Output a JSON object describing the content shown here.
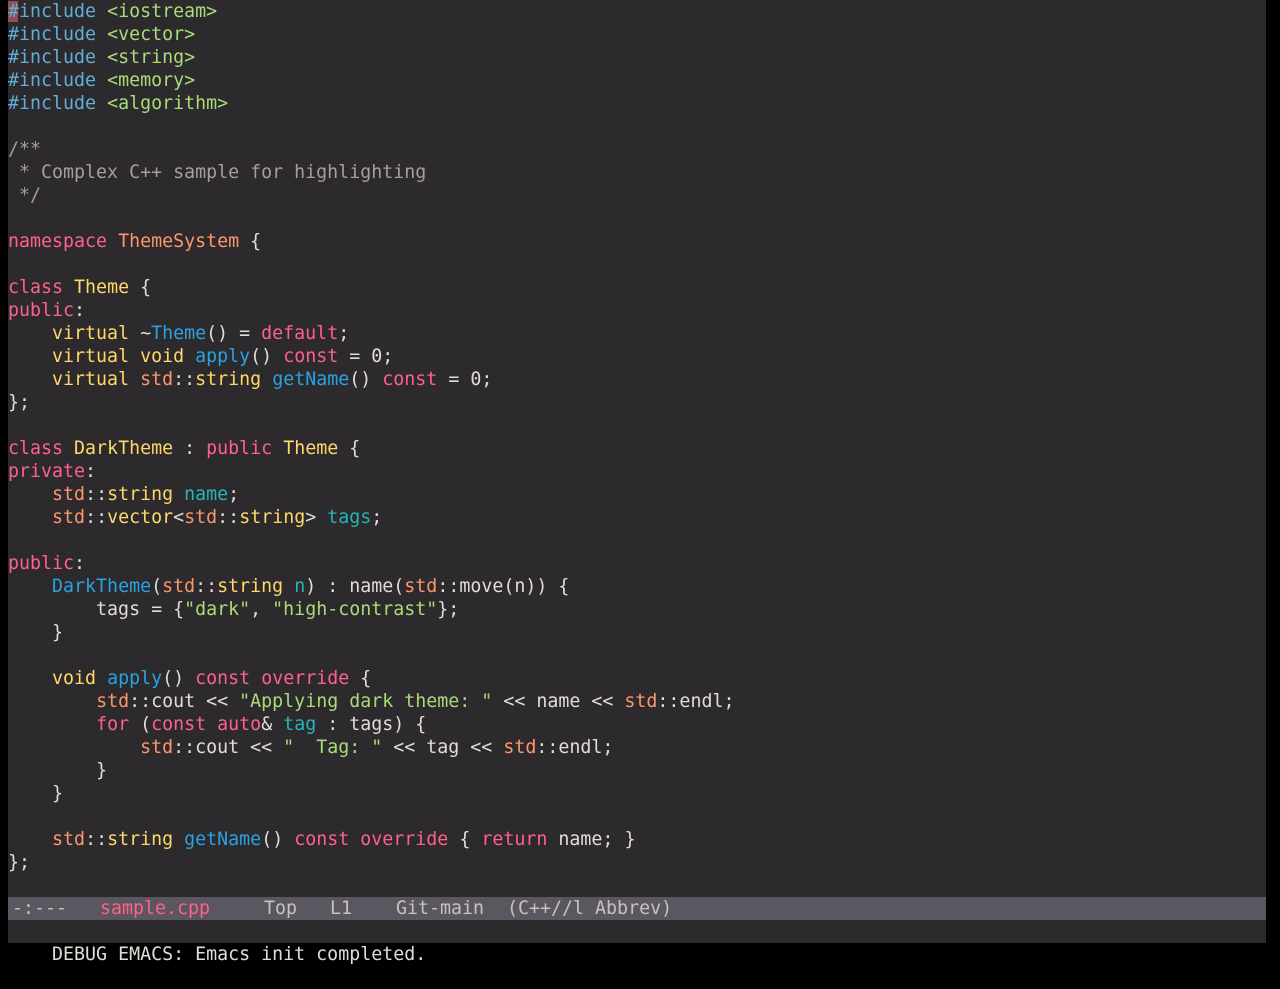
{
  "editor": {
    "lines": [
      [
        {
          "t": "#include",
          "c": "pre"
        },
        {
          "t": " ",
          "c": "plain"
        },
        {
          "t": "<iostream>",
          "c": "inc"
        }
      ],
      [
        {
          "t": "#include",
          "c": "pre"
        },
        {
          "t": " ",
          "c": "plain"
        },
        {
          "t": "<vector>",
          "c": "inc"
        }
      ],
      [
        {
          "t": "#include",
          "c": "pre"
        },
        {
          "t": " ",
          "c": "plain"
        },
        {
          "t": "<string>",
          "c": "inc"
        }
      ],
      [
        {
          "t": "#include",
          "c": "pre"
        },
        {
          "t": " ",
          "c": "plain"
        },
        {
          "t": "<memory>",
          "c": "inc"
        }
      ],
      [
        {
          "t": "#include",
          "c": "pre"
        },
        {
          "t": " ",
          "c": "plain"
        },
        {
          "t": "<algorithm>",
          "c": "inc"
        }
      ],
      [],
      [
        {
          "t": "/**",
          "c": "cmt"
        }
      ],
      [
        {
          "t": " * Complex C++ sample for highlighting",
          "c": "cmt"
        }
      ],
      [
        {
          "t": " */",
          "c": "cmt"
        }
      ],
      [],
      [
        {
          "t": "namespace",
          "c": "kw"
        },
        {
          "t": " ",
          "c": "plain"
        },
        {
          "t": "ThemeSystem",
          "c": "ns"
        },
        {
          "t": " {",
          "c": "plain"
        }
      ],
      [],
      [
        {
          "t": "class",
          "c": "kw"
        },
        {
          "t": " ",
          "c": "plain"
        },
        {
          "t": "Theme",
          "c": "type"
        },
        {
          "t": " {",
          "c": "plain"
        }
      ],
      [
        {
          "t": "public",
          "c": "kw"
        },
        {
          "t": ":",
          "c": "plain"
        }
      ],
      [
        {
          "t": "    ",
          "c": "plain"
        },
        {
          "t": "virtual",
          "c": "type"
        },
        {
          "t": " ~",
          "c": "plain"
        },
        {
          "t": "Theme",
          "c": "fn"
        },
        {
          "t": "() = ",
          "c": "plain"
        },
        {
          "t": "default",
          "c": "kw"
        },
        {
          "t": ";",
          "c": "plain"
        }
      ],
      [
        {
          "t": "    ",
          "c": "plain"
        },
        {
          "t": "virtual",
          "c": "type"
        },
        {
          "t": " ",
          "c": "plain"
        },
        {
          "t": "void",
          "c": "type"
        },
        {
          "t": " ",
          "c": "plain"
        },
        {
          "t": "apply",
          "c": "fn"
        },
        {
          "t": "() ",
          "c": "plain"
        },
        {
          "t": "const",
          "c": "kw"
        },
        {
          "t": " = 0;",
          "c": "plain"
        }
      ],
      [
        {
          "t": "    ",
          "c": "plain"
        },
        {
          "t": "virtual",
          "c": "type"
        },
        {
          "t": " ",
          "c": "plain"
        },
        {
          "t": "std",
          "c": "ns"
        },
        {
          "t": "::",
          "c": "plain"
        },
        {
          "t": "string",
          "c": "type"
        },
        {
          "t": " ",
          "c": "plain"
        },
        {
          "t": "getName",
          "c": "fn"
        },
        {
          "t": "() ",
          "c": "plain"
        },
        {
          "t": "const",
          "c": "kw"
        },
        {
          "t": " = 0;",
          "c": "plain"
        }
      ],
      [
        {
          "t": "};",
          "c": "plain"
        }
      ],
      [],
      [
        {
          "t": "class",
          "c": "kw"
        },
        {
          "t": " ",
          "c": "plain"
        },
        {
          "t": "DarkTheme",
          "c": "type"
        },
        {
          "t": " : ",
          "c": "plain"
        },
        {
          "t": "public",
          "c": "kw"
        },
        {
          "t": " ",
          "c": "plain"
        },
        {
          "t": "Theme",
          "c": "type"
        },
        {
          "t": " {",
          "c": "plain"
        }
      ],
      [
        {
          "t": "private",
          "c": "kw"
        },
        {
          "t": ":",
          "c": "plain"
        }
      ],
      [
        {
          "t": "    ",
          "c": "plain"
        },
        {
          "t": "std",
          "c": "ns"
        },
        {
          "t": "::",
          "c": "plain"
        },
        {
          "t": "string",
          "c": "type"
        },
        {
          "t": " ",
          "c": "plain"
        },
        {
          "t": "name",
          "c": "var"
        },
        {
          "t": ";",
          "c": "plain"
        }
      ],
      [
        {
          "t": "    ",
          "c": "plain"
        },
        {
          "t": "std",
          "c": "ns"
        },
        {
          "t": "::",
          "c": "plain"
        },
        {
          "t": "vector",
          "c": "type"
        },
        {
          "t": "<",
          "c": "plain"
        },
        {
          "t": "std",
          "c": "ns"
        },
        {
          "t": "::",
          "c": "plain"
        },
        {
          "t": "string",
          "c": "type"
        },
        {
          "t": "> ",
          "c": "plain"
        },
        {
          "t": "tags",
          "c": "var"
        },
        {
          "t": ";",
          "c": "plain"
        }
      ],
      [],
      [
        {
          "t": "public",
          "c": "kw"
        },
        {
          "t": ":",
          "c": "plain"
        }
      ],
      [
        {
          "t": "    ",
          "c": "plain"
        },
        {
          "t": "DarkTheme",
          "c": "fn"
        },
        {
          "t": "(",
          "c": "plain"
        },
        {
          "t": "std",
          "c": "ns"
        },
        {
          "t": "::",
          "c": "plain"
        },
        {
          "t": "string",
          "c": "type"
        },
        {
          "t": " ",
          "c": "plain"
        },
        {
          "t": "n",
          "c": "var"
        },
        {
          "t": ") : name(",
          "c": "plain"
        },
        {
          "t": "std",
          "c": "ns"
        },
        {
          "t": "::move(n)) {",
          "c": "plain"
        }
      ],
      [
        {
          "t": "        tags = {",
          "c": "plain"
        },
        {
          "t": "\"dark\"",
          "c": "str"
        },
        {
          "t": ", ",
          "c": "plain"
        },
        {
          "t": "\"high-contrast\"",
          "c": "str"
        },
        {
          "t": "};",
          "c": "plain"
        }
      ],
      [
        {
          "t": "    }",
          "c": "plain"
        }
      ],
      [],
      [
        {
          "t": "    ",
          "c": "plain"
        },
        {
          "t": "void",
          "c": "type"
        },
        {
          "t": " ",
          "c": "plain"
        },
        {
          "t": "apply",
          "c": "fn"
        },
        {
          "t": "() ",
          "c": "plain"
        },
        {
          "t": "const",
          "c": "kw"
        },
        {
          "t": " ",
          "c": "plain"
        },
        {
          "t": "override",
          "c": "kw"
        },
        {
          "t": " {",
          "c": "plain"
        }
      ],
      [
        {
          "t": "        ",
          "c": "plain"
        },
        {
          "t": "std",
          "c": "ns"
        },
        {
          "t": "::cout << ",
          "c": "plain"
        },
        {
          "t": "\"Applying dark theme: \"",
          "c": "str"
        },
        {
          "t": " << name << ",
          "c": "plain"
        },
        {
          "t": "std",
          "c": "ns"
        },
        {
          "t": "::endl;",
          "c": "plain"
        }
      ],
      [
        {
          "t": "        ",
          "c": "plain"
        },
        {
          "t": "for",
          "c": "kw"
        },
        {
          "t": " (",
          "c": "plain"
        },
        {
          "t": "const",
          "c": "kw"
        },
        {
          "t": " ",
          "c": "plain"
        },
        {
          "t": "auto",
          "c": "kw"
        },
        {
          "t": "& ",
          "c": "plain"
        },
        {
          "t": "tag",
          "c": "var"
        },
        {
          "t": " : tags) {",
          "c": "plain"
        }
      ],
      [
        {
          "t": "            ",
          "c": "plain"
        },
        {
          "t": "std",
          "c": "ns"
        },
        {
          "t": "::cout << ",
          "c": "plain"
        },
        {
          "t": "\"  Tag: \"",
          "c": "str"
        },
        {
          "t": " << tag << ",
          "c": "plain"
        },
        {
          "t": "std",
          "c": "ns"
        },
        {
          "t": "::endl;",
          "c": "plain"
        }
      ],
      [
        {
          "t": "        }",
          "c": "plain"
        }
      ],
      [
        {
          "t": "    }",
          "c": "plain"
        }
      ],
      [],
      [
        {
          "t": "    ",
          "c": "plain"
        },
        {
          "t": "std",
          "c": "ns"
        },
        {
          "t": "::",
          "c": "plain"
        },
        {
          "t": "string",
          "c": "type"
        },
        {
          "t": " ",
          "c": "plain"
        },
        {
          "t": "getName",
          "c": "fn"
        },
        {
          "t": "() ",
          "c": "plain"
        },
        {
          "t": "const",
          "c": "kw"
        },
        {
          "t": " ",
          "c": "plain"
        },
        {
          "t": "override",
          "c": "kw"
        },
        {
          "t": " { ",
          "c": "plain"
        },
        {
          "t": "return",
          "c": "kw"
        },
        {
          "t": " name; }",
          "c": "plain"
        }
      ],
      [
        {
          "t": "};",
          "c": "plain"
        }
      ]
    ]
  },
  "modeline": {
    "status": "-:---",
    "buffer_name": "sample.cpp",
    "position": "Top",
    "line": "L1",
    "vc": "Git-main",
    "modes": "(C++//l Abbrev)"
  },
  "minibuffer": {
    "message": "DEBUG EMACS: Emacs init completed."
  },
  "colors": {
    "background": "#2d2a2e",
    "modeline_bg": "#5a5760",
    "preprocessor": "#5fafd7",
    "include": "#a9dc76",
    "comment": "#a59f98",
    "keyword": "#ff6188",
    "type": "#ffd866",
    "namespace": "#fc9867",
    "function": "#29a3e0",
    "string": "#a9dc76",
    "variable": "#26b5b5",
    "cursor": "#e06c75"
  }
}
